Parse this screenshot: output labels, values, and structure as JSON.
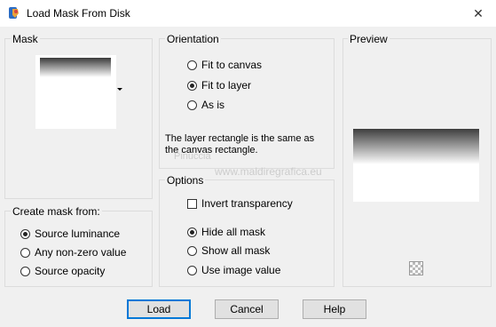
{
  "window": {
    "title": "Load Mask From Disk",
    "close_glyph": "✕",
    "app_icon": "paint-shop-pro-icon"
  },
  "mask": {
    "group_label": "Mask"
  },
  "create_from": {
    "group_label": "Create mask from:",
    "options": [
      "Source luminance",
      "Any non-zero value",
      "Source opacity"
    ],
    "selected": "Source luminance"
  },
  "orientation": {
    "group_label": "Orientation",
    "options": [
      "Fit to canvas",
      "Fit to layer",
      "As is"
    ],
    "selected": "Fit to layer",
    "description_line1": "The layer rectangle is the same as",
    "description_line2": "the canvas rectangle."
  },
  "options": {
    "group_label": "Options",
    "invert_label": "Invert transparency",
    "invert_checked": false,
    "hide_options": [
      "Hide all mask",
      "Show all mask",
      "Use image value"
    ],
    "selected": "Hide all mask"
  },
  "preview": {
    "group_label": "Preview"
  },
  "buttons": {
    "load": "Load",
    "cancel": "Cancel",
    "help": "Help"
  },
  "watermark": {
    "line1": "Pinuccia",
    "line2": "www.maldiregrafica.eu"
  }
}
